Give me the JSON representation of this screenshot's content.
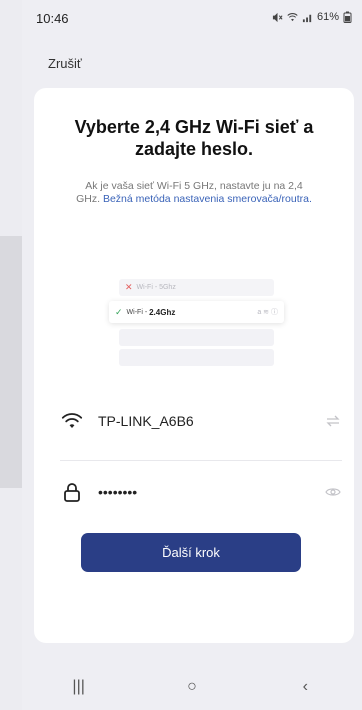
{
  "status": {
    "time": "10:46",
    "battery": "61%",
    "icons": [
      "mute-icon",
      "wifi-icon",
      "signal-icon",
      "battery-icon"
    ]
  },
  "header": {
    "cancel_label": "Zrušiť"
  },
  "card": {
    "title": "Vyberte 2,4 GHz Wi-Fi sieť a zadajte heslo.",
    "subtitle_prefix": "Ak je vaša sieť Wi-Fi 5 GHz, nastavte ju na 2,4 GHz.",
    "subtitle_link": "Bežná metóda nastavenia smerovača/routra.",
    "illustration": {
      "row_5g": "Wi-Fi - 5Ghz",
      "row_24_prefix": "Wi-Fi -",
      "row_24_bold": "2.4Ghz",
      "row_24_right": "a ≋ ⓘ"
    },
    "ssid": "TP-LINK_A6B6",
    "password_mask": "••••••••",
    "next_button": "Ďalší krok"
  },
  "navbar": {
    "recent": "|||",
    "home": "○",
    "back": "‹"
  },
  "colors": {
    "primary_button": "#2a3e86",
    "link": "#3a63b8",
    "card_bg": "#ffffff",
    "page_bg": "#eeeef3"
  }
}
